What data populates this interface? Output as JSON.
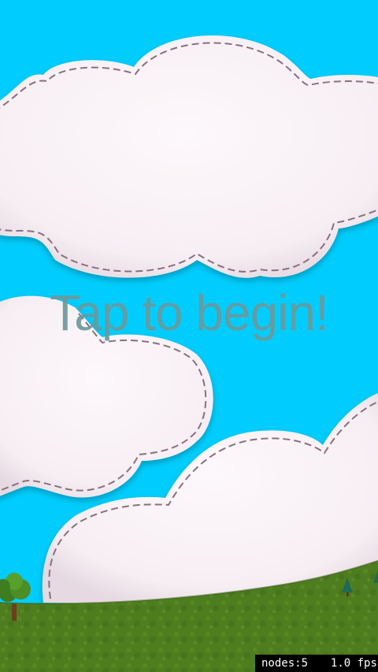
{
  "screen": {
    "prompt": "Tap to begin!"
  },
  "colors": {
    "sky": "#00cdfd",
    "cloud_fill": "#fbf3f7",
    "cloud_stitch": "#8a6f7f",
    "grass": "#4b7a1e",
    "title_text": "#6b9a9c"
  },
  "debug": {
    "nodes_label": "nodes:5",
    "fps_label": "1.0 fps"
  },
  "icons": {
    "tree": "tree-icon",
    "pine": "pine-tree-icon"
  }
}
